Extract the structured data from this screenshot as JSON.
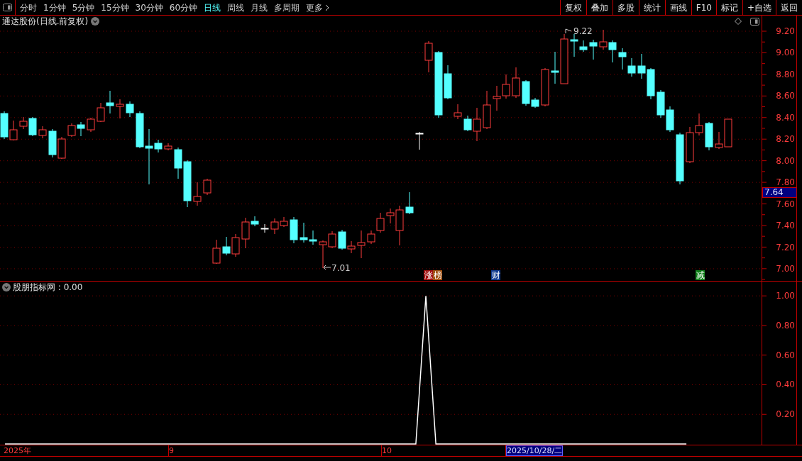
{
  "toolbar": {
    "periods": [
      {
        "label": "分时",
        "selected": false
      },
      {
        "label": "1分钟",
        "selected": false
      },
      {
        "label": "5分钟",
        "selected": false
      },
      {
        "label": "15分钟",
        "selected": false
      },
      {
        "label": "30分钟",
        "selected": false
      },
      {
        "label": "60分钟",
        "selected": false
      },
      {
        "label": "日线",
        "selected": true
      },
      {
        "label": "周线",
        "selected": false
      },
      {
        "label": "月线",
        "selected": false
      },
      {
        "label": "多周期",
        "selected": false
      },
      {
        "label": "更多",
        "selected": false
      }
    ],
    "buttons": [
      "复权",
      "叠加",
      "多股",
      "统计",
      "画线",
      "F10",
      "标记",
      "+自选",
      "返回"
    ]
  },
  "main_chart": {
    "title": "通达股份(日线.前复权)",
    "price_axis": [
      "9.20",
      "9.00",
      "8.80",
      "8.60",
      "8.40",
      "8.20",
      "8.00",
      "7.80",
      "7.60",
      "7.40",
      "7.20",
      "7.00"
    ],
    "current_price": "7.64",
    "high_label": "9.22",
    "low_label": "7.01",
    "event_tags": [
      {
        "label": "涨",
        "color": "#a01010"
      },
      {
        "label": "榜",
        "color": "#a05010"
      },
      {
        "label": "财",
        "color": "#103a90"
      },
      {
        "label": "减",
        "color": "#10801a"
      }
    ]
  },
  "indicator": {
    "title": "股朋指标网 : 0.00",
    "chart_data": {
      "type": "line",
      "ylim": [
        0,
        1.02
      ],
      "grid": true,
      "yticks": [
        {
          "value": 0.2,
          "label": "0.20"
        },
        {
          "value": 0.4,
          "label": "0.40"
        },
        {
          "value": 0.6,
          "label": "0.60"
        },
        {
          "value": 0.8,
          "label": "0.80"
        },
        {
          "value": 1,
          "label": "1.00"
        }
      ],
      "series": [
        {
          "color": "#ffffff",
          "values": [
            0,
            0,
            0,
            0,
            0,
            0,
            0,
            0,
            0,
            0,
            0,
            0,
            0,
            0,
            0,
            0,
            0,
            0,
            0,
            0,
            0,
            0,
            0,
            0,
            0,
            0,
            0,
            0,
            0,
            0,
            0,
            0,
            0,
            0,
            0,
            0,
            0,
            0,
            0,
            0,
            0,
            0,
            1,
            0,
            0,
            0,
            0,
            0,
            0,
            0,
            0,
            0,
            0,
            0,
            0,
            0,
            0,
            0,
            0,
            0,
            0,
            0,
            0,
            0,
            0,
            0,
            0,
            0,
            0,
            null,
            null,
            null,
            null,
            null,
            null,
            null
          ]
        }
      ]
    }
  },
  "time_axis": [
    {
      "label": "2025年",
      "selected": false
    },
    {
      "label": "9",
      "selected": false
    },
    {
      "label": "10",
      "selected": false
    },
    {
      "label": "2025/10/28/二",
      "selected": true
    }
  ]
}
